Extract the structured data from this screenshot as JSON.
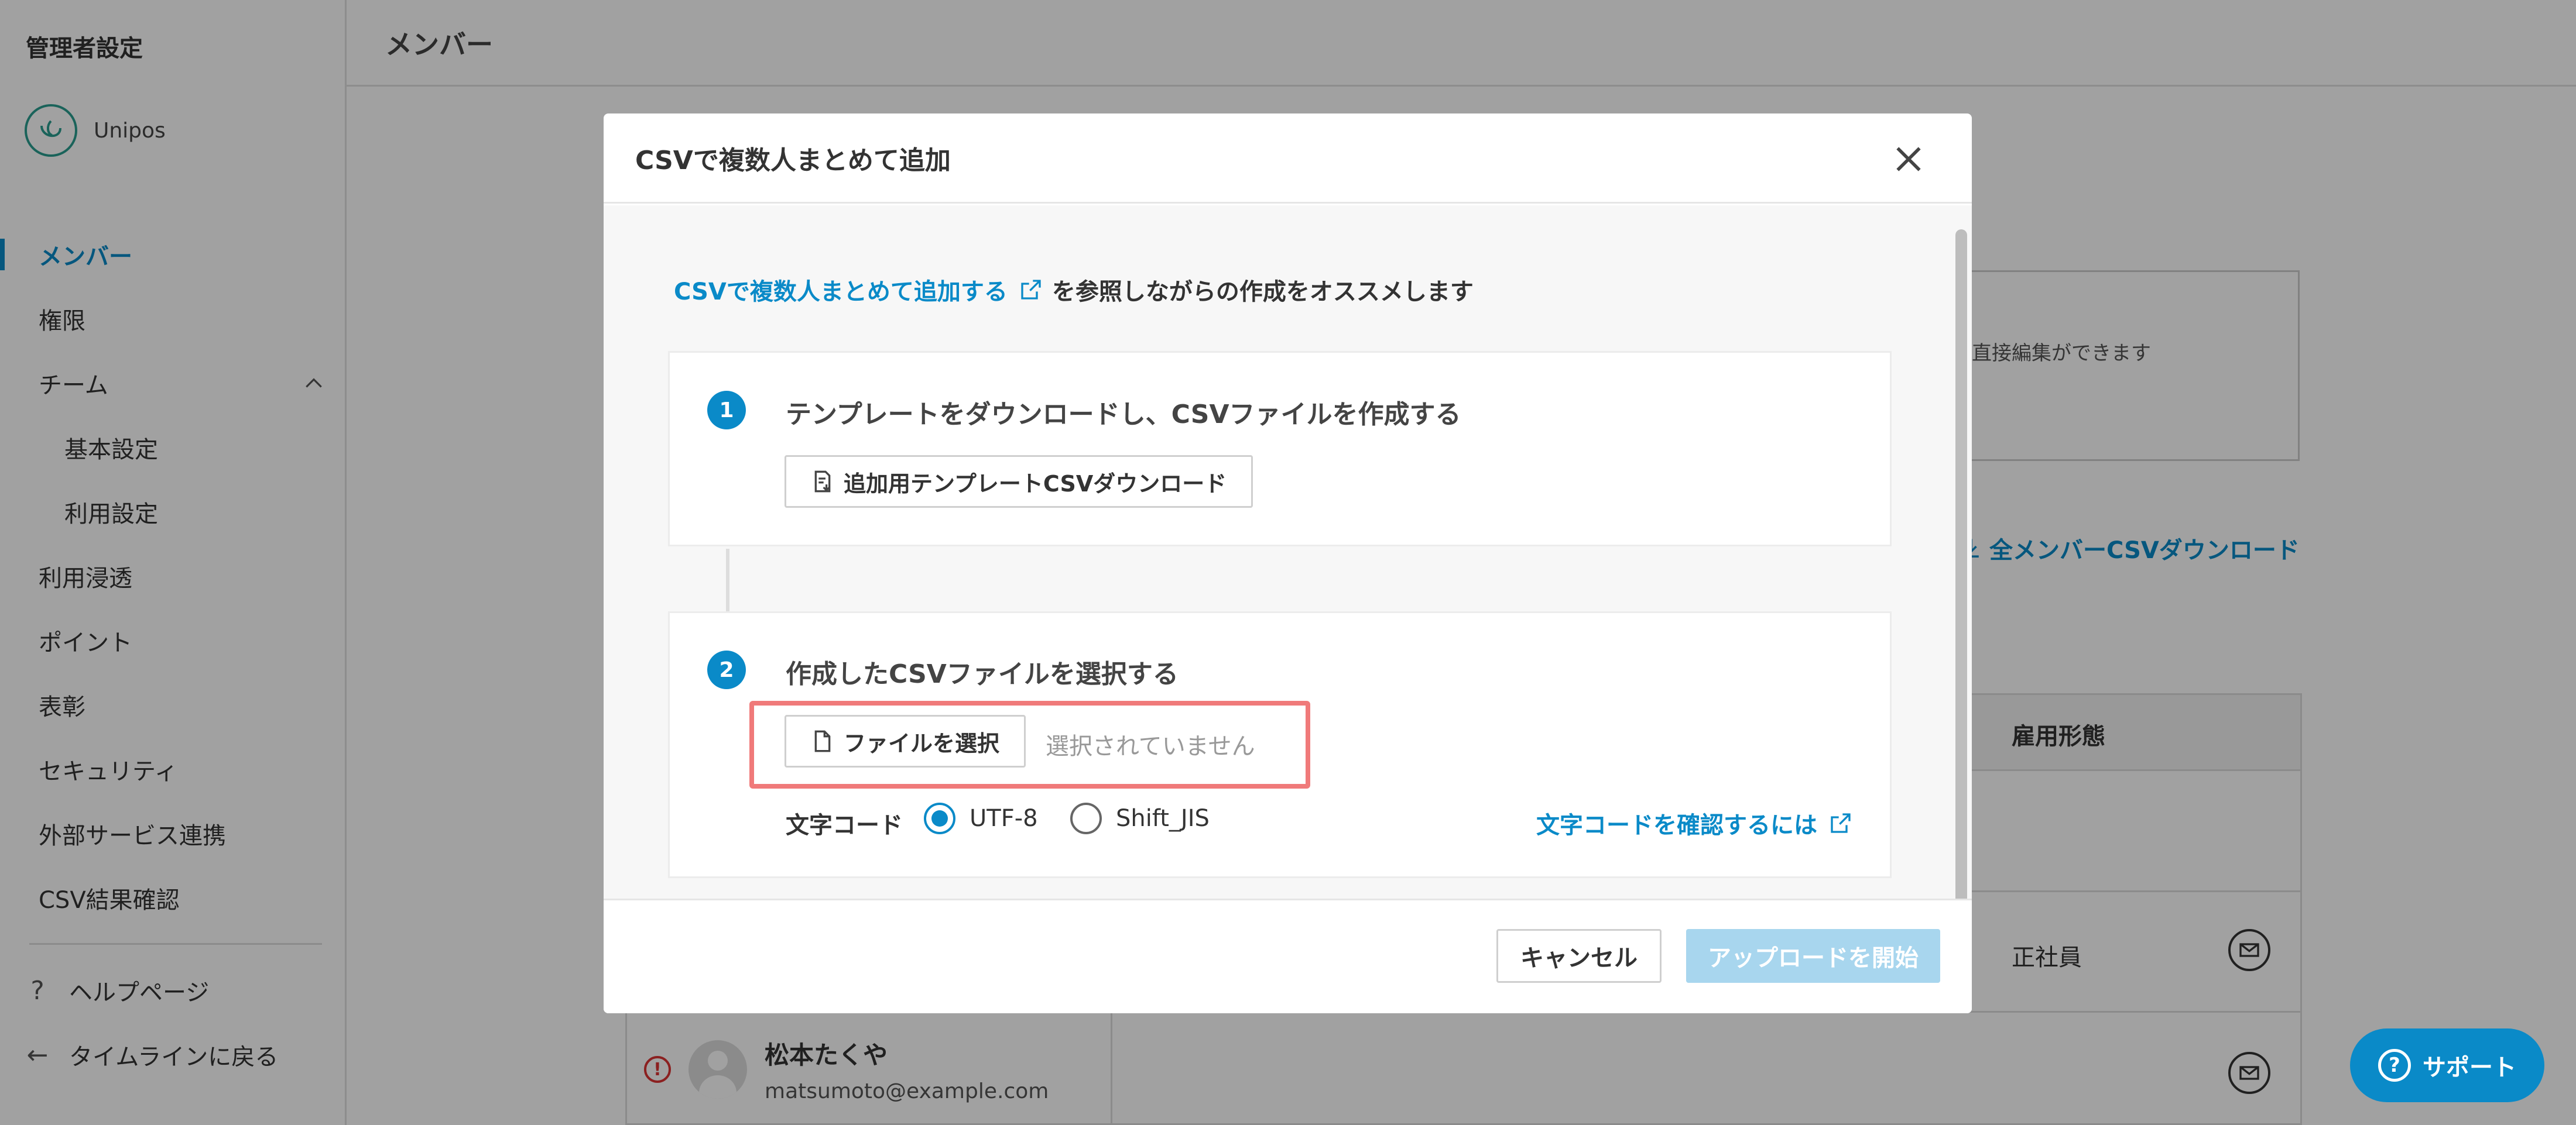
{
  "sidebar": {
    "title": "管理者設定",
    "brand": "Unipos",
    "items": [
      {
        "label": "メンバー",
        "active": true
      },
      {
        "label": "権限"
      },
      {
        "label": "チーム"
      },
      {
        "label": "基本設定"
      },
      {
        "label": "利用設定"
      },
      {
        "label": "利用浸透"
      },
      {
        "label": "ポイント"
      },
      {
        "label": "表彰"
      },
      {
        "label": "セキュリティ"
      },
      {
        "label": "外部サービス連携"
      },
      {
        "label": "CSV結果確認"
      }
    ],
    "help": "ヘルプページ",
    "back": "タイムラインに戻る"
  },
  "main": {
    "title": "メンバー",
    "card_text": "直接編集ができます",
    "download_all": "全メンバーCSVダウンロード",
    "column_employment": "雇用形態",
    "row1_employment": "正社員",
    "member_name": "松本たくや",
    "member_email": "matsumoto@example.com"
  },
  "modal": {
    "title": "CSVで複数人まとめて追加",
    "intro_link": "CSVで複数人まとめて追加する",
    "intro_text": "を参照しながらの作成をオススメします",
    "step1_num": "1",
    "step1_title": "テンプレートをダウンロードし、CSVファイルを作成する",
    "step1_button": "追加用テンプレートCSVダウンロード",
    "step2_num": "2",
    "step2_title": "作成したCSVファイルを選択する",
    "file_button": "ファイルを選択",
    "file_placeholder": "選択されていません",
    "encoding_label": "文字コード",
    "encoding_options": [
      "UTF-8",
      "Shift_JIS"
    ],
    "encoding_selected": "UTF-8",
    "encoding_link": "文字コードを確認するには",
    "cancel": "キャンセル",
    "upload": "アップロードを開始"
  },
  "support": "サポート",
  "colors": {
    "accent": "#0a8ac8",
    "highlight": "#f07a7a",
    "upload_disabled": "#a8d6ee"
  }
}
